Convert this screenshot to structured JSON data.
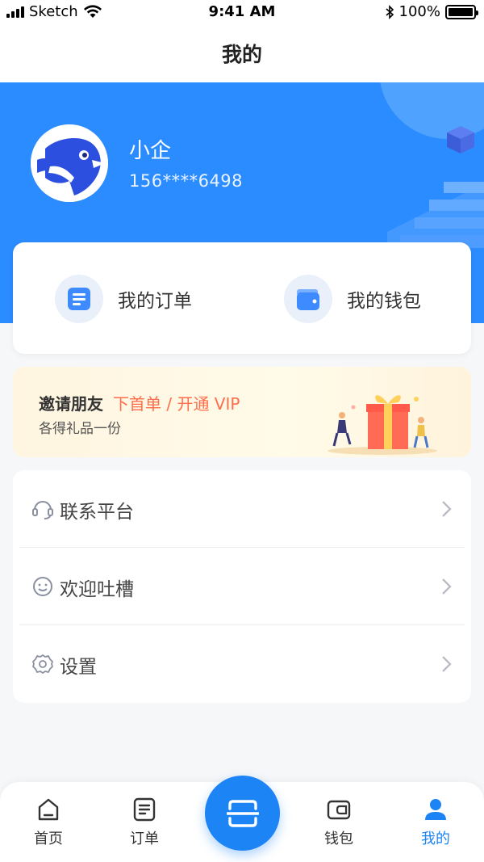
{
  "status_bar": {
    "carrier": "Sketch",
    "time": "9:41 AM",
    "battery": "100%"
  },
  "nav": {
    "title": "我的"
  },
  "profile": {
    "name": "小企",
    "phone": "156****6498"
  },
  "quick_actions": {
    "orders_label": "我的订单",
    "wallet_label": "我的钱包"
  },
  "invite": {
    "title": "邀请朋友",
    "highlight": "下首单 / 开通 VIP",
    "subtitle": "各得礼品一份"
  },
  "menu": [
    {
      "label": "联系平台",
      "icon": "headset-icon"
    },
    {
      "label": "欢迎吐槽",
      "icon": "smile-icon"
    },
    {
      "label": "设置",
      "icon": "gear-icon"
    }
  ],
  "tabs": [
    {
      "label": "首页",
      "icon": "home-icon"
    },
    {
      "label": "订单",
      "icon": "orders-icon"
    },
    {
      "label": "钱包",
      "icon": "wallet-icon"
    },
    {
      "label": "我的",
      "icon": "user-icon",
      "active": true
    }
  ],
  "colors": {
    "primary": "#2b8cff",
    "tab_active": "#1d84f6",
    "highlight": "#ff6d4a"
  }
}
